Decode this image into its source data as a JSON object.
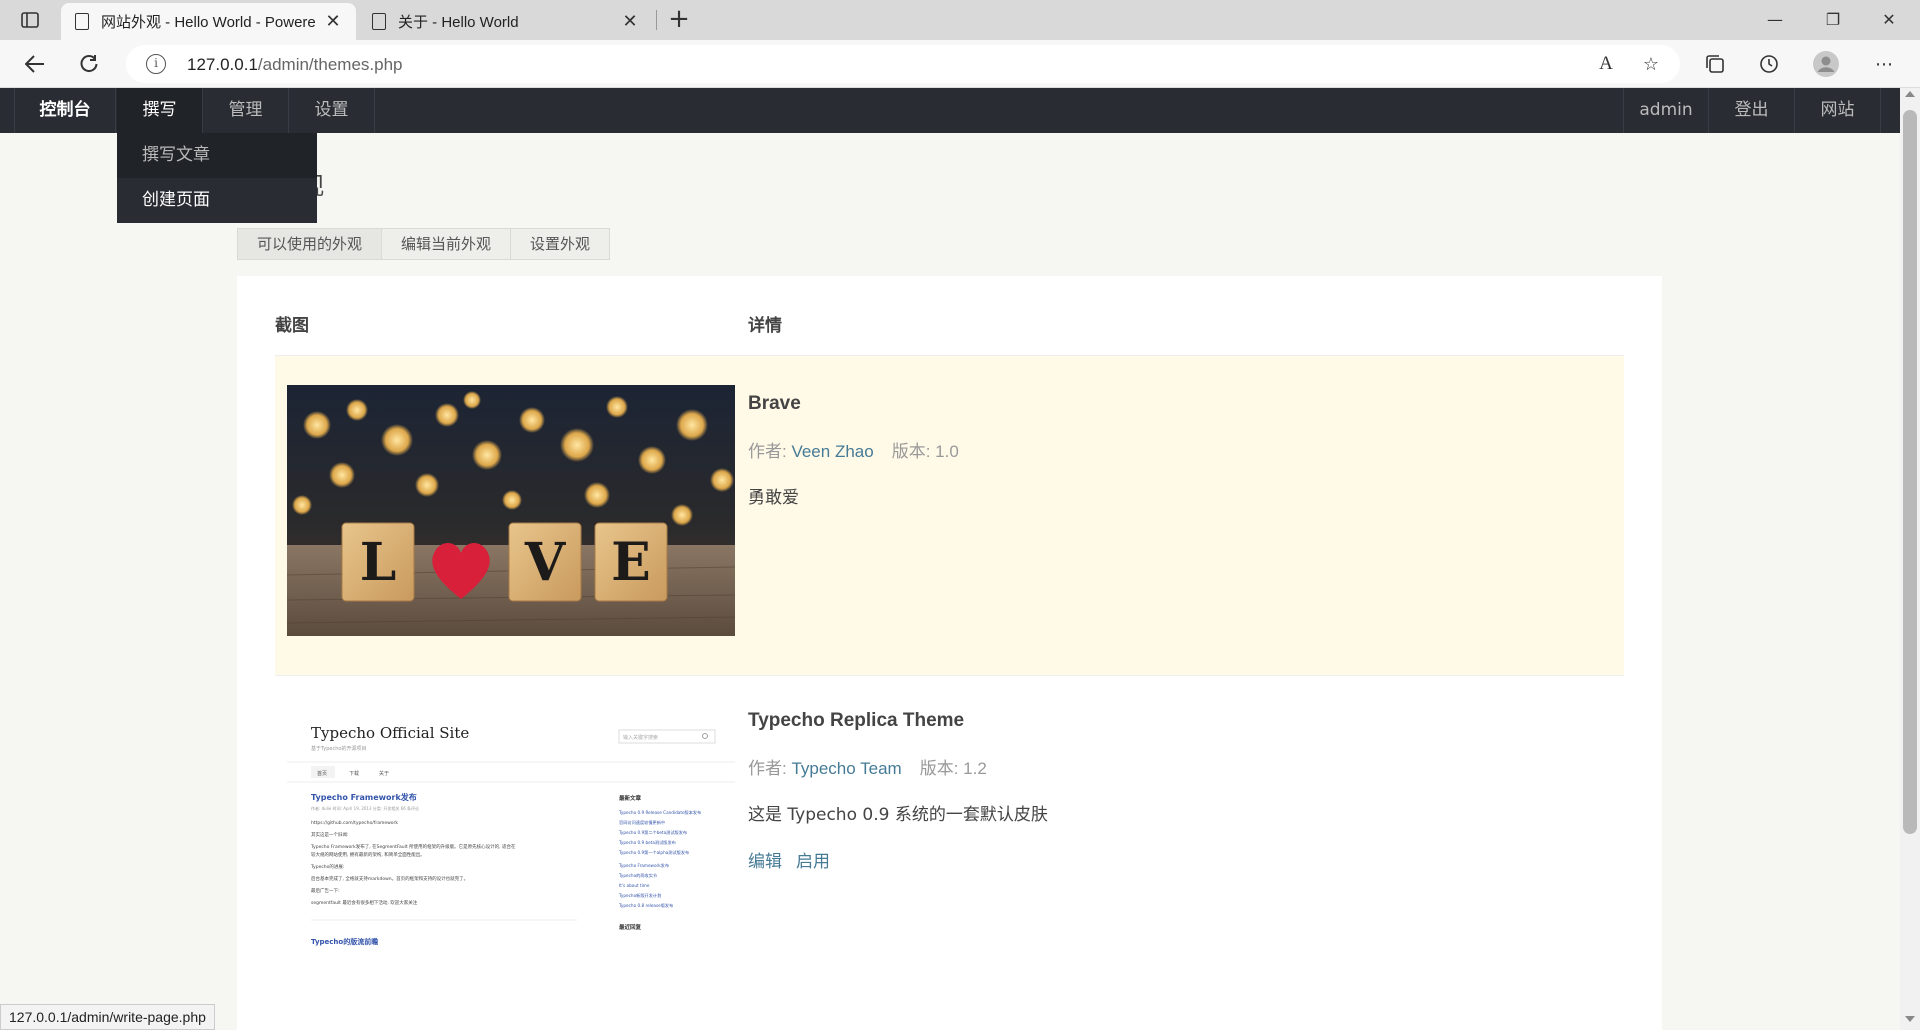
{
  "browser": {
    "tabs": [
      {
        "title": "网站外观 - Hello World - Powere",
        "active": true
      },
      {
        "title": "关于 - Hello World",
        "active": false
      }
    ],
    "url_host": "127.0.0.1",
    "url_path": "/admin/themes.php",
    "status_url": "127.0.0.1/admin/write-page.php"
  },
  "nav": {
    "dashboard": "控制台",
    "write": "撰写",
    "manage": "管理",
    "settings": "设置",
    "user": "admin",
    "logout": "登出",
    "site": "网站"
  },
  "dropdown": {
    "items": [
      "撰写文章",
      "创建页面"
    ]
  },
  "page": {
    "title_visible": "观"
  },
  "typetabs": [
    "可以使用的外观",
    "编辑当前外观",
    "设置外观"
  ],
  "table": {
    "headers": [
      "截图",
      "详情"
    ],
    "themes": [
      {
        "name": "Brave",
        "author_label": "作者: ",
        "author": "Veen Zhao",
        "version": "版本: 1.0",
        "description": "勇敢爱",
        "current": true,
        "screenshot": {
          "letters": [
            "L",
            "V",
            "E"
          ]
        }
      },
      {
        "name": "Typecho Replica Theme",
        "author_label": "作者: ",
        "author": "Typecho Team",
        "version": "版本: 1.2",
        "description": "这是 Typecho 0.9 系统的一套默认皮肤",
        "current": false,
        "ops": [
          "编辑",
          "启用"
        ],
        "screenshot": {
          "site_title": "Typecho Official Site",
          "site_subtitle": "基于Typecho的开源项目",
          "search_placeholder": "输入关键字搜索",
          "menu": [
            "首页",
            "下载",
            "关于"
          ],
          "post_title": "Typecho Framework发布",
          "post_meta": "作者: dulie   时间: April 19, 2013   分类: 开发相关   66 条评论",
          "post_lines": [
            "https://github.com/typecho/framework",
            "其实这是一个旧闻:",
            "Typecho Framework发布了, 在SegmentFault 所使用的框架的升级版。它是原先核心设计的, 适合在",
            "较大规的网站使用, 拥有最新的架构, 和简单全面性能出。",
            "Typecho的进展:",
            "后台基本完成了, 全格就支持markdown。首页的框架和支持的设计也就完了。",
            "最后广告一下:",
            "segmentfault 最近会有很多相下活动, 欢迎大家关注"
          ],
          "recent_title": "最新文章",
          "recent": [
            "Typecho 0.9 Release Candidate版本发布",
            "官网访问速度较慢更新中",
            "Typecho 0.9第二个beta测试版发布",
            "Typecho 0.9 beta测试版发布",
            "Typecho 0.9第一个alpha测试版发布",
            "Typecho Framework发布",
            "Typecho的两攻实节",
            "It's about time",
            "Typecho新版开发计划",
            "Typecho 0.8 release版发布"
          ],
          "comments_title": "最近回复",
          "next_post": "Typecho的版流前瞻"
        }
      }
    ]
  },
  "colors": {
    "nav_bg": "#292d33",
    "link": "#467b96",
    "current_row": "#fff9e8"
  }
}
